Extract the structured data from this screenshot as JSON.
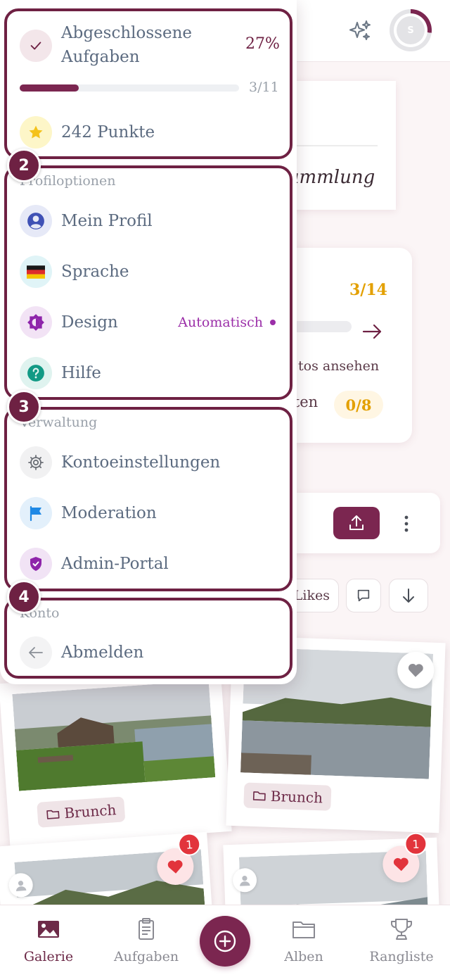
{
  "header": {
    "avatar_initial": "S",
    "avatar_progress_percent": 27
  },
  "background": {
    "card_collection_text": "ammlung",
    "card_tasks_count": "3/14",
    "card_tasks_link_text": "tos ansehen",
    "card_tasks_sub_text": "ften",
    "card_tasks_sub_count": "0/8",
    "filter_likes_label": "Likes",
    "photos": [
      {
        "tag": "Brunch"
      },
      {
        "tag": "Brunch"
      },
      {
        "likes_badge": "1"
      },
      {
        "likes_badge": "1"
      }
    ]
  },
  "dropdown": {
    "progress": {
      "label": "Abgeschlossene Aufgaben",
      "percent_text": "27%",
      "fraction": 0.27,
      "count": "3/11"
    },
    "points": {
      "label": "242 Punkte"
    },
    "steps": [
      "2",
      "3",
      "4"
    ],
    "profile_section": {
      "title": "Profiloptionen",
      "items": [
        {
          "label": "Mein Profil",
          "icon": "user-icon"
        },
        {
          "label": "Sprache",
          "icon": "flag-de-icon"
        },
        {
          "label": "Design",
          "icon": "theme-icon",
          "value": "Automatisch"
        },
        {
          "label": "Hilfe",
          "icon": "help-icon"
        }
      ]
    },
    "admin_section": {
      "title": "Verwaltung",
      "items": [
        {
          "label": "Kontoeinstellungen",
          "icon": "gear-icon"
        },
        {
          "label": "Moderation",
          "icon": "flag-icon"
        },
        {
          "label": "Admin-Portal",
          "icon": "shield-icon"
        }
      ]
    },
    "account_section": {
      "title": "Konto",
      "items": [
        {
          "label": "Abmelden",
          "icon": "arrow-left-icon"
        }
      ]
    }
  },
  "bottom_nav": {
    "items": [
      {
        "label": "Galerie",
        "icon": "image-icon",
        "active": true
      },
      {
        "label": "Aufgaben",
        "icon": "clipboard-icon"
      },
      {
        "label": "Alben",
        "icon": "folder-icon"
      },
      {
        "label": "Rangliste",
        "icon": "trophy-icon"
      }
    ]
  },
  "colors": {
    "brand": "#7b2650",
    "highlight_border": "#6e2143",
    "accent_gold": "#e3a000",
    "accent_purple": "#9b2fa8",
    "like_red": "#e2343c"
  }
}
